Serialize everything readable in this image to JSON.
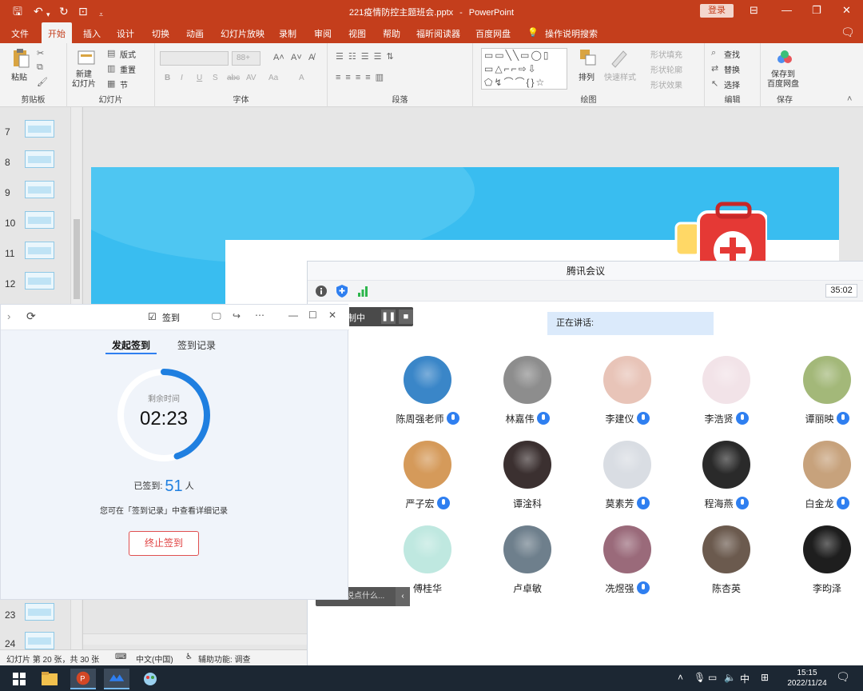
{
  "window": {
    "doc_name": "221疫情防控主题班会.pptx",
    "separator": "-",
    "app_name": "PowerPoint",
    "login_label": "登录"
  },
  "menu": {
    "tabs": [
      "文件",
      "开始",
      "插入",
      "设计",
      "切换",
      "动画",
      "幻灯片放映",
      "录制",
      "审阅",
      "视图",
      "帮助",
      "福昕阅读器",
      "百度网盘"
    ],
    "search_label": "操作说明搜索"
  },
  "ribbon": {
    "clipboard": {
      "group": "剪贴板",
      "paste": "粘贴"
    },
    "slides": {
      "group": "幻灯片",
      "new_slide": "新建\n幻灯片",
      "layout": "版式",
      "reset": "重置",
      "section": "节"
    },
    "font": {
      "group": "字体",
      "size": "88+",
      "buttons": [
        "B",
        "I",
        "U",
        "S",
        "abc",
        "AV",
        "Aa",
        "A"
      ]
    },
    "paragraph": {
      "group": "段落"
    },
    "drawing": {
      "group": "绘图",
      "arrange": "排列",
      "quick_styles": "快速样式",
      "fill": "形状填充",
      "outline": "形状轮廓",
      "effects": "形状效果"
    },
    "editing": {
      "group": "编辑",
      "find": "查找",
      "replace": "替换",
      "select": "选择"
    },
    "save": {
      "group": "保存",
      "save_baidu": "保存到\n百度网盘"
    }
  },
  "slide_thumbnails": [
    {
      "number": "7"
    },
    {
      "number": "8"
    },
    {
      "number": "9"
    },
    {
      "number": "10"
    },
    {
      "number": "11"
    },
    {
      "number": "12"
    },
    {
      "number": "23"
    },
    {
      "number": "24"
    }
  ],
  "statusbar": {
    "slide_info": "幻灯片 第 20 张，共 30 张",
    "language": "中文(中国)",
    "accessibility": "辅助功能: 调查"
  },
  "meeting": {
    "title": "腾讯会议",
    "timer": "35:02",
    "recording": "制中",
    "speaking_label": "正在讲话:",
    "chat_placeholder": "说点什么...",
    "participants": [
      {
        "name": "陈周强老师",
        "mic": true,
        "color": "#3a86c8"
      },
      {
        "name": "林嘉伟",
        "mic": true,
        "color": "#8d8d8d"
      },
      {
        "name": "李建仪",
        "mic": true,
        "color": "#e8c4b8"
      },
      {
        "name": "李浩贤",
        "mic": true,
        "color": "#f2e3e8"
      },
      {
        "name": "谭丽映",
        "mic": true,
        "color": "#a3b879"
      },
      {
        "name": "严子宏",
        "mic": true,
        "color": "#d59a5a"
      },
      {
        "name": "谭淦科",
        "mic": false,
        "color": "#3b3030"
      },
      {
        "name": "莫素芳",
        "mic": true,
        "color": "#d9dde3"
      },
      {
        "name": "程海燕",
        "mic": true,
        "color": "#2a2a2a"
      },
      {
        "name": "白金龙",
        "mic": true,
        "color": "#c7a27c"
      },
      {
        "name": "傅桂华",
        "mic": false,
        "color": "#bfe8e0"
      },
      {
        "name": "卢卓敏",
        "mic": false,
        "color": "#6e7f8c"
      },
      {
        "name": "冼煜强",
        "mic": true,
        "color": "#9a6a7a"
      },
      {
        "name": "陈杏英",
        "mic": false,
        "color": "#6b5a4e"
      },
      {
        "name": "李昀泽",
        "mic": false,
        "color": "#1e1e1e"
      }
    ]
  },
  "signin": {
    "title": "签到",
    "tab_start": "发起签到",
    "tab_records": "签到记录",
    "remaining_label": "剩余时间",
    "remaining_time": "02:23",
    "remaining_fraction": 0.45,
    "signed_label": "已签到:",
    "signed_count": "51",
    "signed_unit": "人",
    "hint": "您可在「签到记录」中查看详细记录",
    "stop_label": "终止签到"
  },
  "taskbar": {
    "ime": "中",
    "time": "15:15",
    "date": "2022/11/24"
  },
  "colors": {
    "ppt_red": "#c43e1c",
    "meeting_blue": "#2f7ff0",
    "ring_blue": "#1f7fe0",
    "stop_red": "#e04040"
  }
}
